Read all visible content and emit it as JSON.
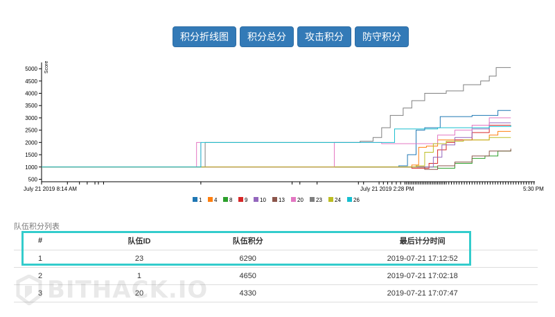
{
  "tabs": [
    {
      "label": "积分折线图"
    },
    {
      "label": "积分总分"
    },
    {
      "label": "攻击积分"
    },
    {
      "label": "防守积分"
    }
  ],
  "chart_data": {
    "type": "line",
    "ylabel": "Score",
    "y_ticks": [
      500,
      1000,
      1500,
      2000,
      2500,
      3000,
      3500,
      4000,
      4500,
      5000
    ],
    "ylim": [
      400,
      5200
    ],
    "x_tick_labels": {
      "first": "July 21 2019 8:14 AM",
      "second": "July 21 2019 2:28 PM",
      "last": "5:30 PM"
    },
    "x_range_minutes": [
      0,
      573
    ],
    "legend_position": "bottom",
    "series": [
      {
        "name": "1",
        "color": "#1f77b4",
        "points": [
          [
            0,
            1000
          ],
          [
            395,
            1000
          ],
          [
            415,
            1050
          ],
          [
            425,
            1500
          ],
          [
            435,
            2500
          ],
          [
            445,
            2600
          ],
          [
            460,
            2600
          ],
          [
            463,
            3050
          ],
          [
            500,
            3100
          ],
          [
            530,
            3300
          ],
          [
            545,
            3300
          ]
        ]
      },
      {
        "name": "4",
        "color": "#ff7f0e",
        "points": [
          [
            0,
            1000
          ],
          [
            395,
            1000
          ],
          [
            430,
            1080
          ],
          [
            438,
            1800
          ],
          [
            447,
            1850
          ],
          [
            460,
            2100
          ],
          [
            500,
            2100
          ],
          [
            520,
            2300
          ],
          [
            530,
            2450
          ],
          [
            545,
            2450
          ]
        ]
      },
      {
        "name": "8",
        "color": "#2ca02c",
        "points": [
          [
            0,
            1000
          ],
          [
            440,
            1000
          ],
          [
            460,
            950
          ],
          [
            480,
            1150
          ],
          [
            500,
            1350
          ],
          [
            515,
            1450
          ],
          [
            530,
            1650
          ],
          [
            545,
            1700
          ]
        ]
      },
      {
        "name": "9",
        "color": "#d62728",
        "points": [
          [
            0,
            1000
          ],
          [
            400,
            1000
          ],
          [
            430,
            950
          ],
          [
            450,
            1150
          ],
          [
            460,
            1700
          ],
          [
            470,
            2000
          ],
          [
            480,
            2100
          ],
          [
            500,
            2400
          ],
          [
            520,
            2700
          ],
          [
            545,
            2700
          ]
        ]
      },
      {
        "name": "10",
        "color": "#9467bd",
        "points": [
          [
            0,
            1000
          ],
          [
            440,
            1000
          ],
          [
            455,
            1400
          ],
          [
            465,
            1900
          ],
          [
            480,
            2200
          ],
          [
            500,
            2550
          ],
          [
            520,
            2800
          ],
          [
            545,
            2800
          ]
        ]
      },
      {
        "name": "13",
        "color": "#8c564b",
        "points": [
          [
            0,
            1000
          ],
          [
            420,
            1000
          ],
          [
            445,
            900
          ],
          [
            460,
            1050
          ],
          [
            480,
            1200
          ],
          [
            500,
            1450
          ],
          [
            520,
            1650
          ],
          [
            545,
            1750
          ]
        ]
      },
      {
        "name": "20",
        "color": "#e377c2",
        "points": [
          [
            0,
            1000
          ],
          [
            180,
            1000
          ],
          [
            180,
            2000
          ],
          [
            185,
            2000
          ],
          [
            185,
            1000
          ],
          [
            300,
            1000
          ],
          [
            340,
            2000
          ],
          [
            395,
            1950
          ],
          [
            440,
            1950
          ],
          [
            460,
            2300
          ],
          [
            480,
            2500
          ],
          [
            500,
            2700
          ],
          [
            520,
            3000
          ],
          [
            545,
            3000
          ]
        ]
      },
      {
        "name": "23",
        "color": "#7f7f7f",
        "points": [
          [
            0,
            1000
          ],
          [
            190,
            1000
          ],
          [
            190,
            2000
          ],
          [
            350,
            2000
          ],
          [
            370,
            2050
          ],
          [
            385,
            2200
          ],
          [
            395,
            2600
          ],
          [
            405,
            3100
          ],
          [
            420,
            3400
          ],
          [
            430,
            3700
          ],
          [
            445,
            4000
          ],
          [
            470,
            4100
          ],
          [
            490,
            4350
          ],
          [
            510,
            4500
          ],
          [
            520,
            4700
          ],
          [
            528,
            5050
          ],
          [
            545,
            5050
          ]
        ]
      },
      {
        "name": "24",
        "color": "#bcbd22",
        "points": [
          [
            0,
            1000
          ],
          [
            400,
            1000
          ],
          [
            420,
            1000
          ],
          [
            435,
            1050
          ],
          [
            445,
            1600
          ],
          [
            455,
            1950
          ],
          [
            470,
            2050
          ],
          [
            490,
            2100
          ],
          [
            520,
            2200
          ],
          [
            545,
            2200
          ]
        ]
      },
      {
        "name": "26",
        "color": "#17becf",
        "points": [
          [
            0,
            1000
          ],
          [
            185,
            1000
          ],
          [
            185,
            2000
          ],
          [
            400,
            2000
          ],
          [
            410,
            2550
          ],
          [
            440,
            2550
          ],
          [
            460,
            2600
          ],
          [
            480,
            2600
          ],
          [
            500,
            2600
          ],
          [
            520,
            2650
          ],
          [
            545,
            2700
          ]
        ]
      }
    ]
  },
  "table": {
    "caption": "队伍积分列表",
    "headers": [
      "#",
      "队伍ID",
      "队伍积分",
      "最后计分时间"
    ],
    "rows": [
      [
        "1",
        "23",
        "6290",
        "2019-07-21 17:12:52"
      ],
      [
        "2",
        "1",
        "4650",
        "2019-07-21 17:02:18"
      ],
      [
        "3",
        "20",
        "4330",
        "2019-07-21 17:07:47"
      ]
    ]
  },
  "watermark": {
    "text": "BITHACK.IO"
  },
  "colors": {
    "button": "#337ab7",
    "highlight": "#33cccc"
  }
}
